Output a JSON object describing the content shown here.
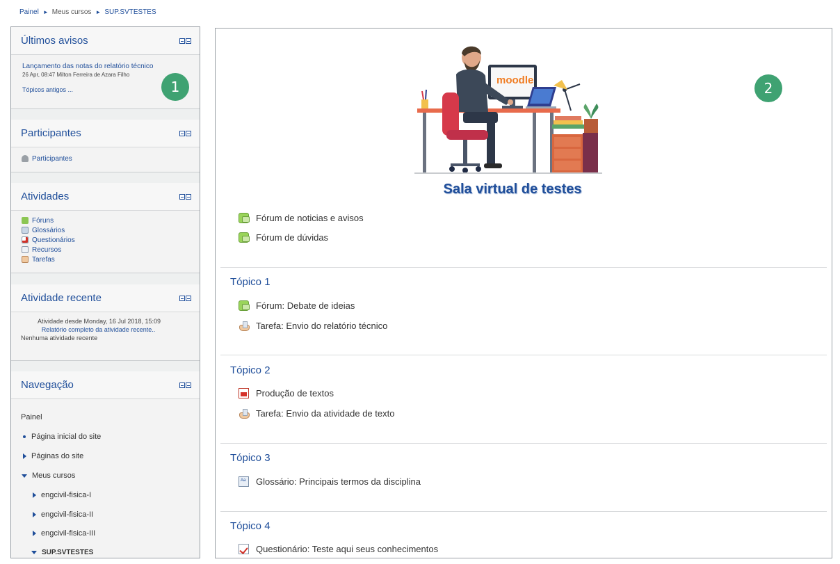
{
  "breadcrumb": {
    "items": [
      "Painel",
      "Meus cursos",
      "SUP.SVTESTES"
    ],
    "separator": "►"
  },
  "badges": {
    "one": "1",
    "two": "2"
  },
  "sidebar": {
    "ultimos_avisos": {
      "title": "Últimos avisos",
      "post_title": "Lançamento das notas do relatório técnico",
      "post_meta": "26 Apr, 08:47  Milton Ferreira de Azara Filho",
      "older": "Tópicos antigos ..."
    },
    "participantes": {
      "title": "Participantes",
      "link": "Participantes"
    },
    "atividades": {
      "title": "Atividades",
      "items": [
        "Fóruns",
        "Glossários",
        "Questionários",
        "Recursos",
        "Tarefas"
      ]
    },
    "atividade_recente": {
      "title": "Atividade recente",
      "since": "Atividade desde Monday, 16 Jul 2018, 15:09",
      "report": "Relatório completo da atividade recente..",
      "none": "Nenhuma atividade recente"
    },
    "navegacao": {
      "title": "Navegação",
      "painel": "Painel",
      "pagina_inicial": "Página inicial do site",
      "paginas": "Páginas do site",
      "meus_cursos": "Meus cursos",
      "cursos": [
        "engcivil-fisica-I",
        "engcivil-fisica-II",
        "engcivil-fisica-III"
      ],
      "atual": "SUP.SVTESTES"
    }
  },
  "main": {
    "banner_logo": "moodle",
    "course_title": "Sala virtual de testes",
    "general": [
      "Fórum de noticias e avisos",
      "Fórum de dúvidas"
    ],
    "topics": [
      {
        "title": "Tópico 1",
        "items": [
          "Fórum: Debate de ideias",
          "Tarefa: Envio do relatório técnico"
        ]
      },
      {
        "title": "Tópico 2",
        "items": [
          "Produção de textos",
          "Tarefa: Envio da atividade de texto"
        ]
      },
      {
        "title": "Tópico 3",
        "items": [
          "Glossário: Principais termos da disciplina"
        ]
      },
      {
        "title": "Tópico 4",
        "items": [
          "Questionário: Teste aqui seus conhecimentos"
        ]
      }
    ]
  },
  "colors": {
    "link": "#1f4e9a",
    "badge": "#3fa272"
  }
}
